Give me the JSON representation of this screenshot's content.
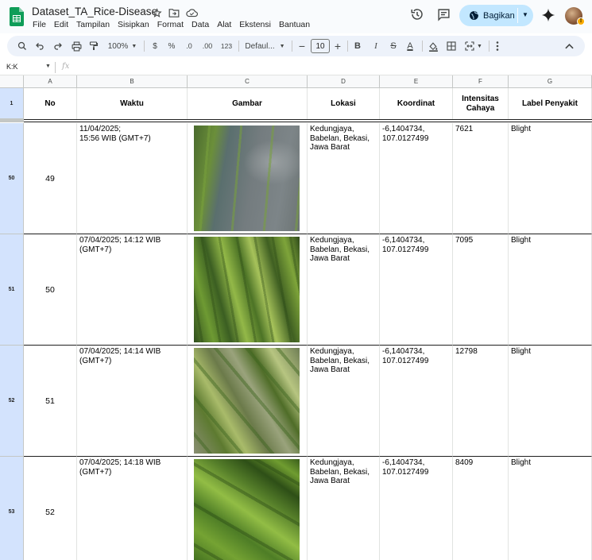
{
  "app": {
    "title": "Dataset_TA_Rice-Disease",
    "menu": [
      "File",
      "Edit",
      "Tampilan",
      "Sisipkan",
      "Format",
      "Data",
      "Alat",
      "Ekstensi",
      "Bantuan"
    ],
    "share_label": "Bagikan"
  },
  "toolbar": {
    "zoom": "100%",
    "currency": "$",
    "percent": "%",
    "dec_decrease": ".0",
    "dec_increase": ".00",
    "number_format": "123",
    "font": "Defaul...",
    "font_size": "10",
    "bold": "B",
    "italic": "I",
    "strike": "S",
    "text_color": "A"
  },
  "formula_bar": {
    "name_box": "K:K",
    "fx": "fx"
  },
  "columns": [
    "A",
    "B",
    "C",
    "D",
    "E",
    "F",
    "G"
  ],
  "header_row": {
    "row_number": "1",
    "cells": [
      "No",
      "Waktu",
      "Gambar",
      "Lokasi",
      "Koordinat",
      "Intensitas Cahaya",
      "Label Penyakit"
    ]
  },
  "rows": [
    {
      "row_number": "50",
      "no": "49",
      "waktu": "11/04/2025;\n 15:56 WIB (GMT+7)",
      "lokasi": "Kedungjaya,\nBabelan, Bekasi,\nJawa Barat",
      "koordinat": "-6,1404734,\n107.0127499",
      "intensitas": "7621",
      "label": "Blight"
    },
    {
      "row_number": "51",
      "no": "50",
      "waktu": "07/04/2025; 14:12 WIB\n(GMT+7)",
      "lokasi": "Kedungjaya,\nBabelan, Bekasi,\nJawa Barat",
      "koordinat": "-6,1404734,\n107.0127499",
      "intensitas": "7095",
      "label": "Blight"
    },
    {
      "row_number": "52",
      "no": "51",
      "waktu": "07/04/2025; 14:14 WIB\n(GMT+7)",
      "lokasi": "Kedungjaya,\nBabelan, Bekasi,\nJawa Barat",
      "koordinat": "-6,1404734,\n107.0127499",
      "intensitas": "12798",
      "label": "Blight"
    },
    {
      "row_number": "53",
      "no": "52",
      "waktu": "07/04/2025; 14:18 WIB\n(GMT+7)",
      "lokasi": "Kedungjaya,\nBabelan, Bekasi,\nJawa Barat",
      "koordinat": "-6,1404734,\n107.0127499",
      "intensitas": "8409",
      "label": "Blight"
    }
  ],
  "colors": {
    "share_bg": "#c2e7ff",
    "toolbar_bg": "#edf2fa",
    "row_header_selected": "#d3e3fd",
    "sheets_green": "#0f9d58"
  }
}
